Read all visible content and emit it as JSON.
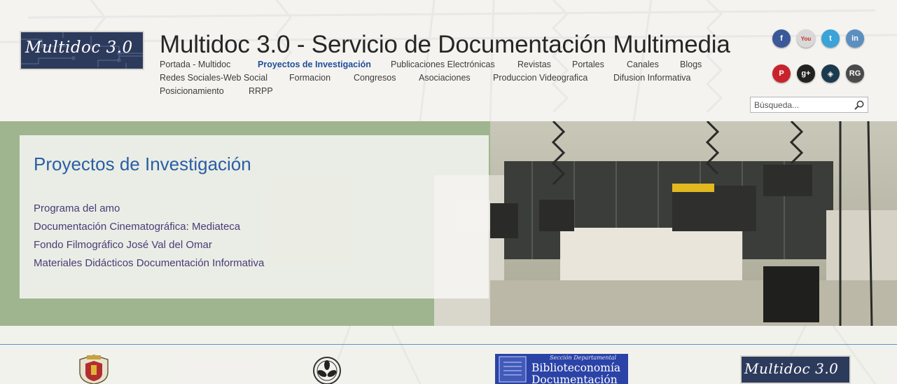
{
  "site": {
    "logo_text": "Multidoc 3.0",
    "title": "Multidoc 3.0 - Servicio de Documentación Multimedia"
  },
  "nav": {
    "row1": [
      {
        "label": "Portada - Multidoc",
        "active": false
      },
      {
        "label": "Proyectos de Investigación",
        "active": true
      },
      {
        "label": "Publicaciones Electrónicas",
        "active": false
      },
      {
        "label": "Revistas",
        "active": false
      },
      {
        "label": "Portales",
        "active": false
      },
      {
        "label": "Canales",
        "active": false
      },
      {
        "label": "Blogs",
        "active": false
      }
    ],
    "row2": [
      {
        "label": "Redes Sociales-Web Social"
      },
      {
        "label": "Formacion"
      },
      {
        "label": "Congresos"
      },
      {
        "label": "Asociaciones"
      },
      {
        "label": "Produccion Videografica"
      },
      {
        "label": "Difusion Informativa"
      }
    ],
    "row3": [
      {
        "label": "Posicionamiento"
      },
      {
        "label": "RRPP"
      }
    ]
  },
  "social": [
    {
      "name": "facebook-icon",
      "glyph": "f",
      "color": "#3b5998"
    },
    {
      "name": "youtube-icon",
      "glyph": "You",
      "color": "#d9d9d9"
    },
    {
      "name": "twitter-icon",
      "glyph": "t",
      "color": "#3aa3d8"
    },
    {
      "name": "linkedin-icon",
      "glyph": "in",
      "color": "#5b8fc0"
    },
    {
      "name": "pinterest-icon",
      "glyph": "P",
      "color": "#c8232c"
    },
    {
      "name": "googleplus-icon",
      "glyph": "g+",
      "color": "#222222"
    },
    {
      "name": "academia-icon",
      "glyph": "◈",
      "color": "#1c3a4e"
    },
    {
      "name": "researchgate-icon",
      "glyph": "RG",
      "color": "#4a4a4a"
    }
  ],
  "search": {
    "placeholder": "Búsqueda..."
  },
  "main": {
    "title": "Proyectos de Investigación",
    "links": [
      "Programa del amo",
      "Documentación Cinematográfica: Mediateca",
      "Fondo Filmográfico José Val del Omar",
      "Materiales Didácticos Documentación Informativa"
    ]
  },
  "footer": {
    "bib_small": "Sección Departamental",
    "bib_line1": "Biblioteconomía",
    "bib_line2": "Documentación",
    "logo_text": "Multidoc 3.0"
  },
  "colors": {
    "accent": "#1f4f9a",
    "panel_title": "#2a5ea5",
    "link": "#4b3a77",
    "divider": "#5d93c7"
  }
}
